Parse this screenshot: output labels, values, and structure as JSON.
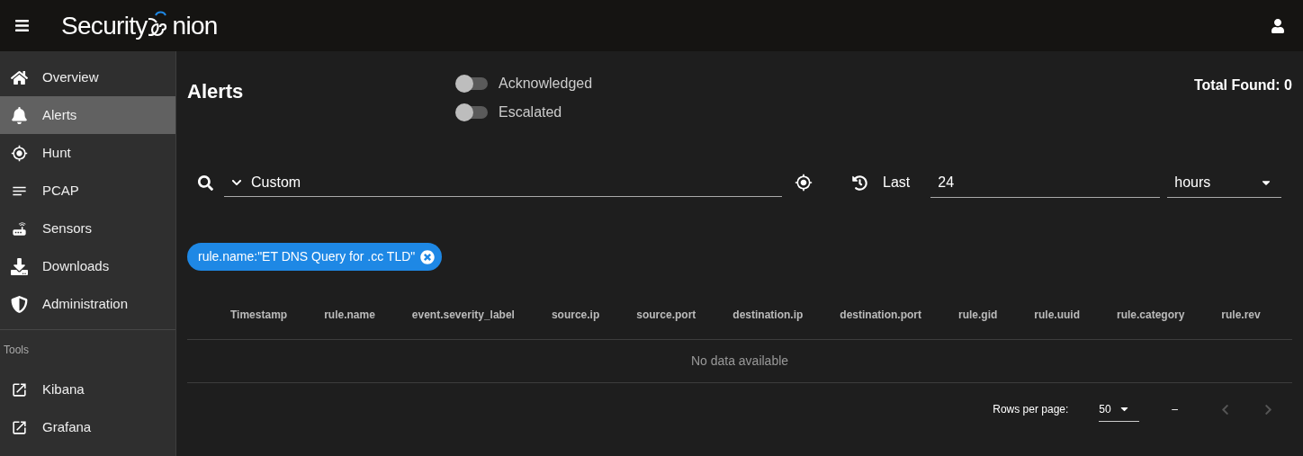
{
  "header": {
    "logo_prefix": "Security",
    "logo_suffix": "nion"
  },
  "sidebar": {
    "items": [
      {
        "label": "Overview",
        "selected": false
      },
      {
        "label": "Alerts",
        "selected": true
      },
      {
        "label": "Hunt",
        "selected": false
      },
      {
        "label": "PCAP",
        "selected": false
      },
      {
        "label": "Sensors",
        "selected": false
      },
      {
        "label": "Downloads",
        "selected": false
      },
      {
        "label": "Administration",
        "selected": false
      }
    ],
    "section": "Tools",
    "tools": [
      {
        "label": "Kibana",
        "selected": false
      },
      {
        "label": "Grafana",
        "selected": false
      }
    ]
  },
  "page": {
    "title": "Alerts",
    "toggles": [
      {
        "label": "Acknowledged",
        "on": false
      },
      {
        "label": "Escalated",
        "on": false
      }
    ],
    "total": "Total Found: 0"
  },
  "query": {
    "value": "Custom",
    "range_label": "Last",
    "range_value": "24",
    "range_unit": "hours"
  },
  "filters": [
    {
      "label": "rule.name:\"ET DNS Query for .cc TLD\""
    }
  ],
  "table": {
    "columns": [
      "Timestamp",
      "rule.name",
      "event.severity_label",
      "source.ip",
      "source.port",
      "destination.ip",
      "destination.port",
      "rule.gid",
      "rule.uuid",
      "rule.category",
      "rule.rev"
    ],
    "empty": "No data available"
  },
  "pagination": {
    "rows_label": "Rows per page:",
    "rows_value": "50",
    "range": "–"
  }
}
